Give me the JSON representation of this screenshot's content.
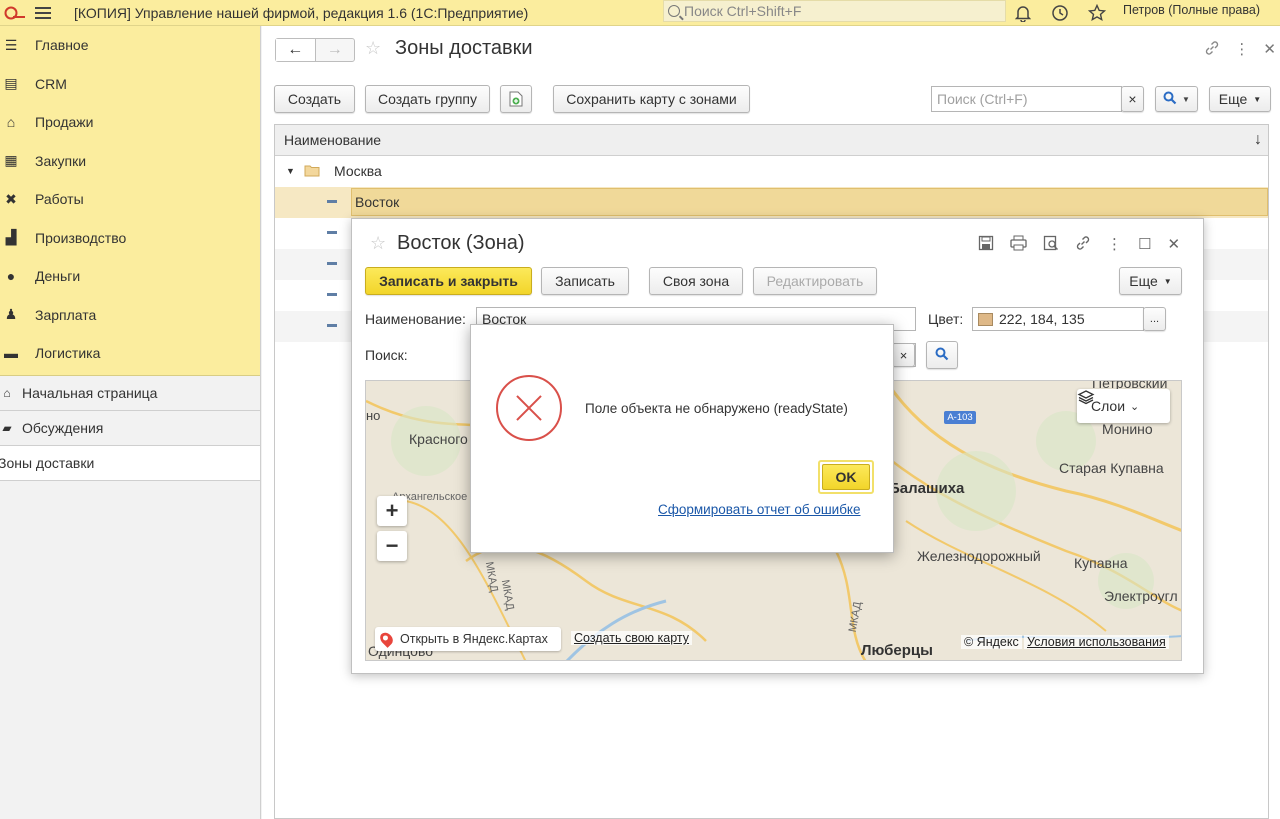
{
  "topbar": {
    "title": "[КОПИЯ] Управление нашей фирмой, редакция 1.6  (1С:Предприятие)",
    "search_placeholder": "Поиск Ctrl+Shift+F",
    "user": "Петров (Полные права)"
  },
  "sidebar": {
    "sections": [
      {
        "label": "Главное",
        "icon": "menu-lines-icon"
      },
      {
        "label": "CRM",
        "icon": "crm-icon"
      },
      {
        "label": "Продажи",
        "icon": "basket-icon"
      },
      {
        "label": "Закупки",
        "icon": "purchases-icon"
      },
      {
        "label": "Работы",
        "icon": "tools-icon"
      },
      {
        "label": "Производство",
        "icon": "factory-icon"
      },
      {
        "label": "Деньги",
        "icon": "coin-icon"
      },
      {
        "label": "Зарплата",
        "icon": "people-icon"
      },
      {
        "label": "Логистика",
        "icon": "truck-icon"
      }
    ],
    "nav": [
      {
        "label": "Начальная страница",
        "icon": "home-icon"
      },
      {
        "label": "Обсуждения",
        "icon": "chat-icon"
      },
      {
        "label": "Зоны доставки",
        "icon": ""
      }
    ]
  },
  "main": {
    "title": "Зоны доставки",
    "toolbar": {
      "create": "Создать",
      "create_group": "Создать группу",
      "save_map": "Сохранить карту с зонами",
      "search_placeholder": "Поиск (Ctrl+F)",
      "clear": "×",
      "more": "Еще"
    },
    "list": {
      "column": "Наименование",
      "group": "Москва",
      "selected": "Восток"
    }
  },
  "form": {
    "title": "Восток (Зона)",
    "buttons": {
      "save_close": "Записать и закрыть",
      "save": "Записать",
      "own_zone": "Своя зона",
      "edit": "Редактировать",
      "more": "Еще"
    },
    "name_label": "Наименование:",
    "name_value": "Восток",
    "color_label": "Цвет:",
    "color_value": "222, 184, 135",
    "color_hex": "#deb887",
    "color_more": "...",
    "search_label": "Поиск:",
    "search_clear": "×",
    "map": {
      "labels": [
        "Петровский",
        "Монино",
        "Старая Купавна",
        "Балашиха",
        "Красного",
        "Архангельское",
        "Железнодорожный",
        "Купавна",
        "Электроугл",
        "Люберцы",
        "Одинцово",
        "МКАД",
        "МКАД",
        "МКАД",
        "но"
      ],
      "road_badge": "A-103",
      "layers": "Слои",
      "zoom_in": "+",
      "zoom_out": "−",
      "open_yandex": "Открыть в Яндекс.Картах",
      "create_map": "Создать свою карту",
      "copyright": "© Яндекс",
      "terms": "Условия использования"
    }
  },
  "dialog": {
    "message": "Поле объекта не обнаружено (readyState)",
    "ok": "OK",
    "report_link": "Сформировать отчет об ошибке"
  }
}
